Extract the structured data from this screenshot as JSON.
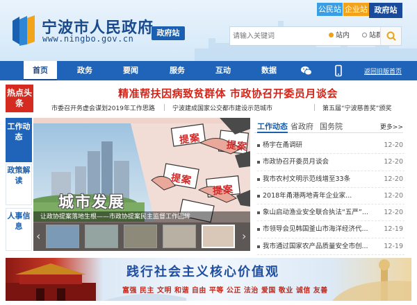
{
  "header": {
    "site_title": "宁波市人民政府",
    "site_url": "www.ningbo.gov.cn",
    "badge": "政府站",
    "top_links": [
      "公民站",
      "企业站",
      "政府站"
    ],
    "search": {
      "placeholder": "请输入关键词",
      "scope_options": [
        "站内",
        "站群"
      ],
      "selected_scope": "站内"
    }
  },
  "nav": {
    "items": [
      "首页",
      "政务",
      "要闻",
      "服务",
      "互动",
      "数据"
    ],
    "active": "首页",
    "icons": [
      "wechat-icon",
      "mobile-icon"
    ],
    "back_link": "返回旧版首页"
  },
  "hot": {
    "badge": "热点头条",
    "headline": "精准帮扶因病致贫群体 市政协召开委员月谈会",
    "sub_links": [
      "市委召开务虚会谋划2019年工作思路",
      "宁波建成国家公交都市建设示范城市",
      "第五届“宁波慈善奖”颁奖"
    ]
  },
  "left_tabs": [
    "工作动态",
    "政策解读",
    "人事信息"
  ],
  "feature": {
    "overlay_text": "城市发展",
    "placard_text": "提案",
    "caption": "让政协提案落地生根——市政协提案民主监督工作回眸"
  },
  "news_panel": {
    "tabs": [
      "工作动态",
      "省政府",
      "国务院"
    ],
    "active_tab": "工作动态",
    "more": "更多>>",
    "items": [
      {
        "title": "杨宇在甬调研",
        "date": "12-20"
      },
      {
        "title": "市政协召开委员月谈会",
        "date": "12-20"
      },
      {
        "title": "我市农村文明示范线增至33条",
        "date": "12-20"
      },
      {
        "title": "2018年甬港两地青年企业家...",
        "date": "12-20"
      },
      {
        "title": "象山启动渔业安全联合执法“五严”...",
        "date": "12-20"
      },
      {
        "title": "市领导会见韩国釜山市海洋经济代...",
        "date": "12-19"
      },
      {
        "title": "我市通过国家农产品质量安全市创...",
        "date": "12-19"
      }
    ]
  },
  "banner": {
    "title": "践行社会主义核心价值观",
    "values": "富强 民主 文明 和谐 自由 平等 公正 法治 爱国 敬业 诚信 友善"
  },
  "colors": {
    "primary_blue": "#1f64b8",
    "hot_red": "#d42a1f",
    "headline_red": "#d4251a",
    "dark_blue": "#1a4a8c"
  }
}
